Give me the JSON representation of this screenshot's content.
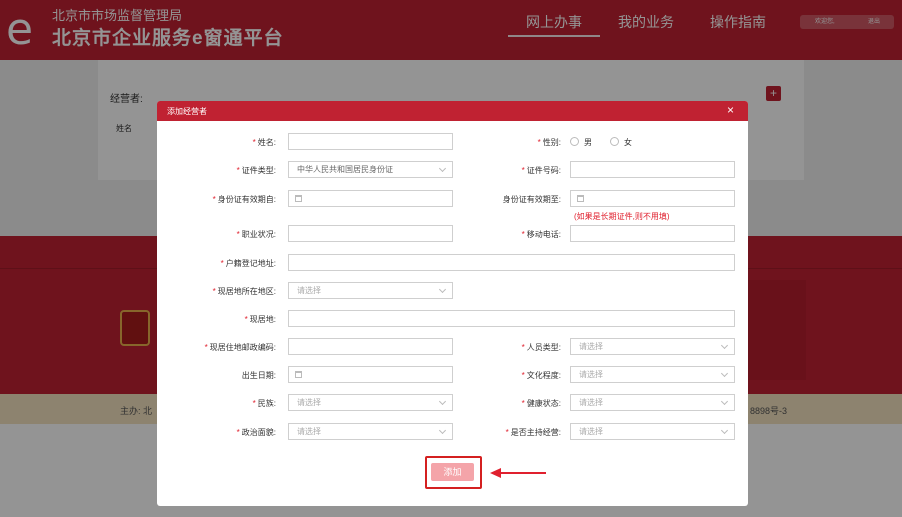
{
  "header": {
    "agency": "北京市市场监督管理局",
    "platform": "北京市企业服务e窗通平台",
    "nav": [
      "网上办事",
      "我的业务",
      "操作指南"
    ],
    "user_welcome": "欢迎您,",
    "logout": "退出"
  },
  "background": {
    "operator_label": "经营者:",
    "name_col": "姓名",
    "footer_left": "主办: 北",
    "footer_right": "8898号-3"
  },
  "modal": {
    "title": "添加经营者",
    "close": "×",
    "required_mark": "*",
    "fields": {
      "name": {
        "label": "姓名:"
      },
      "gender": {
        "label": "性别:",
        "options": [
          "男",
          "女"
        ]
      },
      "id_type": {
        "label": "证件类型:",
        "value": "中华人民共和国居民身份证"
      },
      "id_number": {
        "label": "证件号码:"
      },
      "id_valid_from": {
        "label": "身份证有效期自:"
      },
      "id_valid_to": {
        "label": "身份证有效期至:",
        "note": "(如果是长期证件,则不用填)"
      },
      "occupation": {
        "label": "职业状况:"
      },
      "mobile": {
        "label": "移动电话:"
      },
      "household_address": {
        "label": "户籍登记地址:"
      },
      "residence_region": {
        "label": "现居地所在地区:",
        "placeholder": "请选择"
      },
      "residence": {
        "label": "现居地:"
      },
      "postal_code": {
        "label": "现居住地邮政编码:"
      },
      "person_type": {
        "label": "人员类型:",
        "placeholder": "请选择"
      },
      "birth_date": {
        "label": "出生日期:"
      },
      "education": {
        "label": "文化程度:",
        "placeholder": "请选择"
      },
      "ethnicity": {
        "label": "民族:",
        "placeholder": "请选择"
      },
      "health": {
        "label": "健康状态:",
        "placeholder": "请选择"
      },
      "political": {
        "label": "政治面貌:",
        "placeholder": "请选择"
      },
      "is_host": {
        "label": "是否主持经营:",
        "placeholder": "请选择"
      }
    },
    "submit": "添加"
  },
  "colors": {
    "brand": "#c02232",
    "required": "#e0202e",
    "submit_bg": "#f4a4a9"
  }
}
